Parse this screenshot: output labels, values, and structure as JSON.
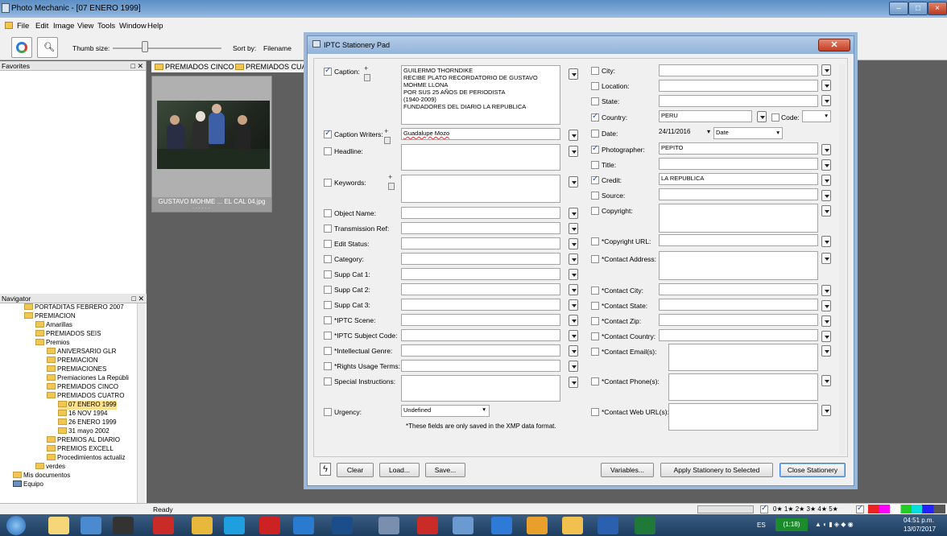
{
  "window": {
    "title": "Photo Mechanic - [07 ENERO 1999]"
  },
  "menu": [
    "File",
    "Edit",
    "Image",
    "View",
    "Tools",
    "Window",
    "Help"
  ],
  "toolbar": {
    "thumb_label": "Thumb size:",
    "sort_label": "Sort by:",
    "sort_value": "Filename"
  },
  "favorites": {
    "title": "Favorites"
  },
  "navigator": {
    "title": "Navigator",
    "items": [
      "PORTADITAS FEBRERO 2007",
      "PREMIACION",
      "Amarillas",
      "PREMIADOS SEIS",
      "Premios",
      "ANIVERSARIO GLR",
      "PREMIACION",
      "PREMIACIONES",
      "Premiaciones La Repúbli",
      "PREMIADOS CINCO",
      "PREMIADOS CUATRO",
      "07 ENERO 1999",
      "16 NOV  1994",
      "26 ENERO  1999",
      "31 mayo 2002",
      "PREMIOS AL DIARIO",
      "PREMIOS EXCELL",
      "Procedimientos actualiz",
      "verdes",
      "Mis documentos",
      "Equipo"
    ]
  },
  "tabs": [
    "PREMIADOS CINCO",
    "PREMIADOS CUAT"
  ],
  "thumb": {
    "filename": "GUSTAVO  MOHME ... EL CAL 04.jpg",
    "stars": ". . . . . ."
  },
  "dialog": {
    "title": "IPTC Stationery Pad",
    "caption_label": "Caption:",
    "caption_value": "GUILERMO THORNDIKE\nRECIBE PLATO RECORDATORIO DE GUSTAVO MOHME LLONA\nPOR SUS 25 AÑOS DE PERIODISTA\n(1940-2009)\nFUNDADORES DEL DIARIO LA REPUBLICA",
    "caption_writers_label": "Caption Writers:",
    "caption_writers_value": "Guadalupe Mozo",
    "left_labels": [
      "Headline:",
      "Keywords:",
      "Object Name:",
      "Transmission Ref:",
      "Edit Status:",
      "Category:",
      "Supp Cat 1:",
      "Supp Cat 2:",
      "Supp Cat 3:",
      "*IPTC Scene:",
      "*IPTC Subject Code:",
      "*Intellectual Genre:",
      "*Rights Usage Terms:",
      "Special Instructions:",
      "Urgency:"
    ],
    "urgency_value": "Undefined",
    "note": "*These fields are only saved in the XMP data format.",
    "right_labels": [
      "City:",
      "Location:",
      "State:",
      "Country:",
      "Date:",
      "Photographer:",
      "Title:",
      "Credit:",
      "Source:",
      "Copyright:",
      "*Copyright URL:",
      "*Contact Address:",
      "*Contact City:",
      "*Contact State:",
      "*Contact Zip:",
      "*Contact Country:",
      "*Contact Email(s):",
      "*Contact Phone(s):",
      "*Contact Web URL(s):"
    ],
    "country_value": "PERU",
    "code_label": "Code:",
    "date_value": "24/11/2016",
    "date_mode": "Date",
    "photographer_value": "PEPITO",
    "credit_value": "LA REPUBLICA",
    "buttons": {
      "clear": "Clear",
      "load": "Load...",
      "save": "Save...",
      "variables": "Variables...",
      "apply": "Apply Stationery to Selected",
      "close": "Close Stationery"
    }
  },
  "status": {
    "text": "Ready",
    "stars": "0★ 1★ 2★ 3★ 4★ 5★"
  },
  "taskbar": {
    "lang": "ES",
    "time": "04:51 p.m.",
    "date": "13/07/2017",
    "badge": "(1:18)"
  }
}
